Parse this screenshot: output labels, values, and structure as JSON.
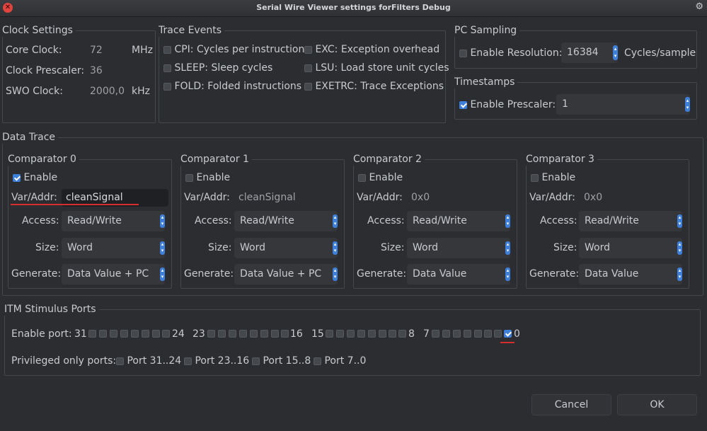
{
  "window": {
    "title": "Serial Wire Viewer settings forFilters Debug"
  },
  "clock_settings": {
    "title": "Clock Settings",
    "core_clock": {
      "label": "Core Clock:",
      "value": "72",
      "unit": "MHz"
    },
    "clock_prescaler": {
      "label": "Clock Prescaler:",
      "value": "36"
    },
    "swo_clock": {
      "label": "SWO Clock:",
      "value": "2000,0",
      "unit": "kHz"
    }
  },
  "trace_events": {
    "title": "Trace Events",
    "items": [
      {
        "label": "CPI: Cycles per instruction",
        "checked": false
      },
      {
        "label": "SLEEP: Sleep cycles",
        "checked": false
      },
      {
        "label": "FOLD: Folded instructions",
        "checked": false
      },
      {
        "label": "EXC: Exception overhead",
        "checked": false
      },
      {
        "label": "LSU: Load store unit cycles",
        "checked": false
      },
      {
        "label": "EXETRC: Trace Exceptions",
        "checked": false
      }
    ]
  },
  "pc_sampling": {
    "title": "PC Sampling",
    "enable_label": "Enable Resolution:",
    "enabled": false,
    "resolution": "16384",
    "unit": "Cycles/sample"
  },
  "timestamps": {
    "title": "Timestamps",
    "enable_label": "Enable Prescaler:",
    "enabled": true,
    "prescaler": "1"
  },
  "data_trace": {
    "title": "Data Trace",
    "labels": {
      "enable": "Enable",
      "var_addr": "Var/Addr:",
      "access": "Access:",
      "size": "Size:",
      "generate": "Generate:"
    },
    "comparators": [
      {
        "title": "Comparator 0",
        "enabled": true,
        "var_addr": "cleanSignal",
        "access": "Read/Write",
        "size": "Word",
        "generate": "Data Value + PC"
      },
      {
        "title": "Comparator 1",
        "enabled": false,
        "var_addr": "cleanSignal",
        "access": "Read/Write",
        "size": "Word",
        "generate": "Data Value + PC"
      },
      {
        "title": "Comparator 2",
        "enabled": false,
        "var_addr": "0x0",
        "access": "Read/Write",
        "size": "Word",
        "generate": "Data Value"
      },
      {
        "title": "Comparator 3",
        "enabled": false,
        "var_addr": "0x0",
        "access": "Read/Write",
        "size": "Word",
        "generate": "Data Value"
      }
    ]
  },
  "itm": {
    "title": "ITM Stimulus Ports",
    "enable_port_label": "Enable port:",
    "groups": [
      {
        "high": "31",
        "low": "24"
      },
      {
        "high": "23",
        "low": "16"
      },
      {
        "high": "15",
        "low": "8"
      },
      {
        "high": "7",
        "low": "0"
      }
    ],
    "enabled_ports": [
      0
    ],
    "privileged_label": "Privileged only ports:",
    "privileged_ports": [
      {
        "label": "Port 31..24",
        "checked": false
      },
      {
        "label": "Port 23..16",
        "checked": false
      },
      {
        "label": "Port 15..8",
        "checked": false
      },
      {
        "label": "Port 7..0",
        "checked": false
      }
    ]
  },
  "buttons": {
    "cancel": "Cancel",
    "ok": "OK"
  },
  "colors": {
    "accent": "#3d7fd9",
    "annotation": "#d62d2d",
    "background": "#2b2d30"
  }
}
